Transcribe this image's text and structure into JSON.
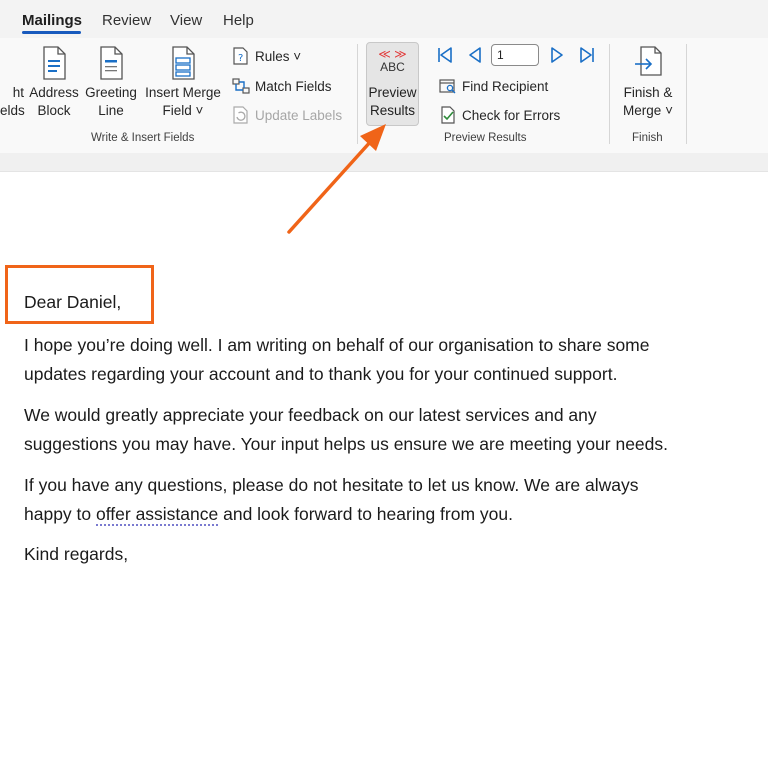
{
  "tabs": [
    "Mailings",
    "Review",
    "View",
    "Help"
  ],
  "ribbon": {
    "write_insert": {
      "partial_label_top": "ht",
      "partial_label_bottom": "elds",
      "address_block": [
        "Address",
        "Block"
      ],
      "greeting_line": [
        "Greeting",
        "Line"
      ],
      "insert_merge_field": [
        "Insert Merge",
        "Field ˅"
      ],
      "rules": "Rules ˅",
      "match_fields": "Match Fields",
      "update_labels": "Update Labels",
      "group_label": "Write & Insert Fields"
    },
    "preview": {
      "preview_results": [
        "Preview",
        "Results"
      ],
      "abc_label": "ABC",
      "record_value": "1",
      "find_recipient": "Find Recipient",
      "check_errors": "Check for Errors",
      "group_label": "Preview Results"
    },
    "finish": {
      "finish_merge": [
        "Finish &",
        "Merge ˅"
      ],
      "group_label": "Finish"
    }
  },
  "document": {
    "greeting": "Dear Daniel,",
    "paragraphs": [
      {
        "lines": [
          "I hope you’re doing well. I am writing on behalf of our organisation to share some",
          "updates regarding your account and to thank you for your continued support."
        ]
      },
      {
        "lines": [
          "We would greatly appreciate your feedback on our latest services and any",
          "suggestions you may have. Your input helps us ensure we are meeting your needs."
        ]
      },
      {
        "line1": "If you have any questions, please do not hesitate to let us know. We are always",
        "line2_before": "happy to ",
        "line2_link": "offer assistance",
        "line2_after": " and look forward to hearing from you."
      }
    ],
    "closing": "Kind regards,"
  },
  "colors": {
    "accent": "#185abd",
    "annotation": "#f06418"
  }
}
